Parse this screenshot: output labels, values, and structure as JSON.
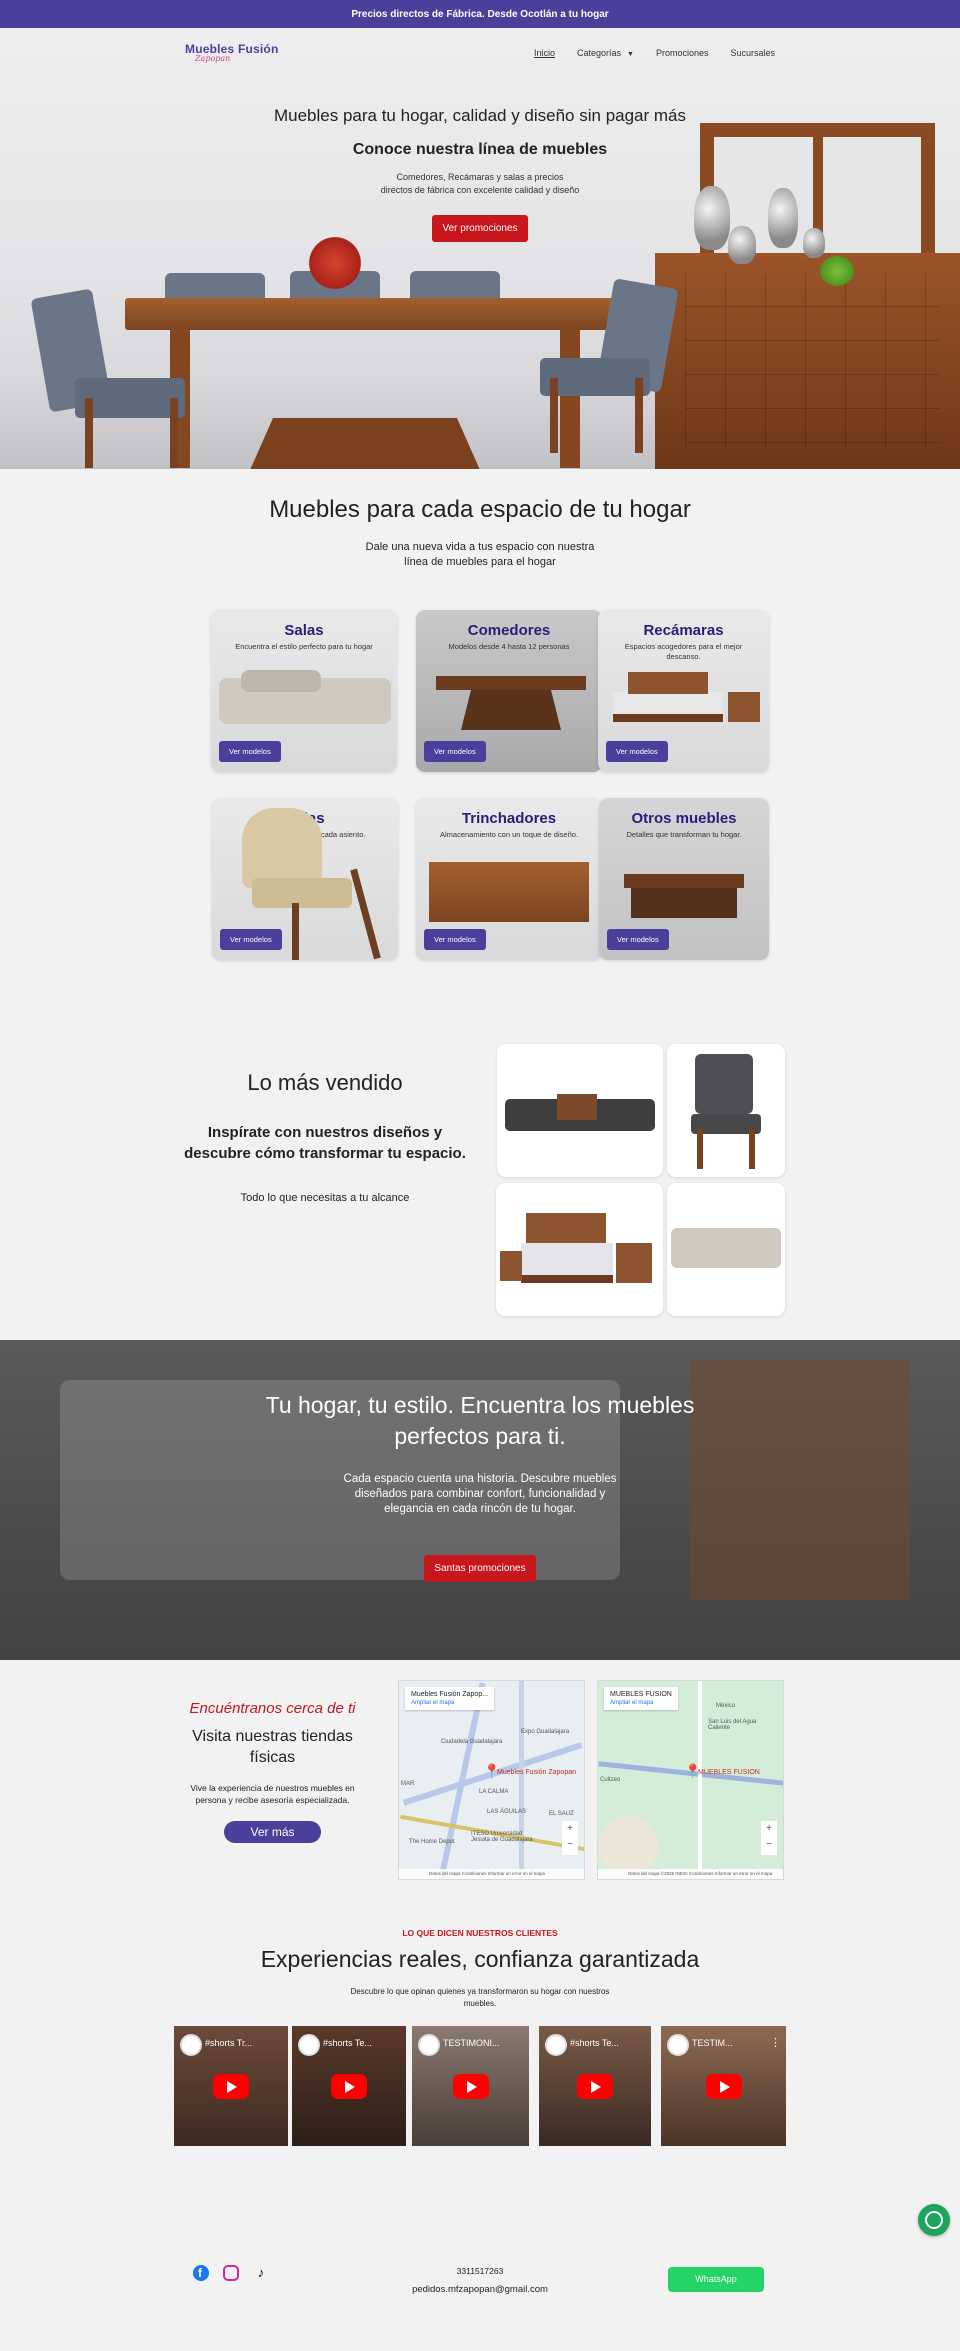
{
  "topbar": {
    "text": "Precios directos de Fábrica. Desde Ocotlán a tu hogar"
  },
  "logo": {
    "brand": "Muebles Fusión",
    "tagline": "Zapopan"
  },
  "nav": {
    "items": [
      "Inicio",
      "Categorías",
      "Promociones",
      "Sucursales"
    ]
  },
  "hero": {
    "headline": "Muebles para tu hogar, calidad y diseño sin pagar más",
    "subheadline": "Conoce nuestra línea de muebles",
    "description": "Comedores, Recámaras y salas a precios\ndirectos de fábrica con excelente calidad y diseño",
    "cta": "Ver promociones"
  },
  "espacios": {
    "title": "Muebles para cada espacio de tu hogar",
    "subtitle": "Dale una nueva vida a tus espacio con nuestra\nlínea de muebles para el hogar",
    "cards": [
      {
        "title": "Salas",
        "desc": "Encuentra el estilo perfecto para tu hogar",
        "button": "Ver modelos"
      },
      {
        "title": "Comedores",
        "desc": "Modelos desde 4 hasta 12 personas",
        "button": "Ver modelos"
      },
      {
        "title": "Recámaras",
        "desc": "Espacios acogedores para el mejor descanso.",
        "button": "Ver modelos"
      },
      {
        "title": "Sillas",
        "desc": "Elegancia y confort en cada asiento.",
        "button": "Ver modelos"
      },
      {
        "title": "Trinchadores",
        "desc": "Almacenamiento con un toque de diseño.",
        "button": "Ver modelos"
      },
      {
        "title": "Otros muebles",
        "desc": "Detalles que transforman tu hogar.",
        "button": "Ver modelos"
      }
    ]
  },
  "vendido": {
    "title": "Lo más vendido",
    "subtitle": "Inspírate con nuestros diseños y\ndescubre cómo transformar tu espacio.",
    "text": "Todo lo que necesitas a tu alcance"
  },
  "banner": {
    "title": "Tu hogar, tu estilo. Encuentra los muebles\nperfectos para ti.",
    "text": "Cada espacio cuenta una historia. Descubre muebles\ndiseñados para combinar confort, funcionalidad y\nelegancia en cada rincón de tu hogar.",
    "cta": "Santas promociones"
  },
  "tiendas": {
    "kicker": "Encuéntranos cerca de ti",
    "title": "Visita nuestras tiendas\nfísicas",
    "text": "Vive la experiencia de nuestros muebles en\npersona y recibe asesoría especializada.",
    "cta": "Ver más",
    "maps": [
      {
        "name": "Muebles Fusión Zapop...",
        "enlarge": "Ampliar el mapa",
        "pin_label": "Muebles Fusión Zapopan",
        "places": [
          "Expo Guadalajara",
          "Ciudadela Guadalajara",
          "LA CALMA",
          "LAS ÁGUILAS",
          "The Home Depot",
          "ITESO Universidad Jesuita de Guadalajara",
          "MAR",
          "EL SAUZ"
        ],
        "footer": "Datos del mapa   Condiciones   Informar un error en el mapa"
      },
      {
        "name": "MUEBLES FUSION",
        "enlarge": "Ampliar el mapa",
        "pin_label": "MUEBLES FUSION",
        "places": [
          "México",
          "San Luis del Agua Caliente",
          "Cuitzeo"
        ],
        "footer": "Datos del mapa ©2025 INEGI   Condiciones   Informar un error en el mapa"
      }
    ]
  },
  "testimonios": {
    "eyebrow": "LO QUE DICEN NUESTROS CLIENTES",
    "title": "Experiencias reales, confianza garantizada",
    "text": "Descubre lo que opinan quienes ya transformaron su hogar con nuestros\nmuebles.",
    "videos": [
      "#shorts Tr...",
      "#shorts Te...",
      "TESTIMONI...",
      "#shorts Te...",
      "TESTIM..."
    ]
  },
  "footer": {
    "phone": "3311517263",
    "email": "pedidos.mfzapopan@gmail.com",
    "whatsapp": "WhatsApp"
  },
  "colors": {
    "brand_purple": "#4b3f9c",
    "accent_red": "#c8161d",
    "whatsapp_green": "#25d366"
  }
}
